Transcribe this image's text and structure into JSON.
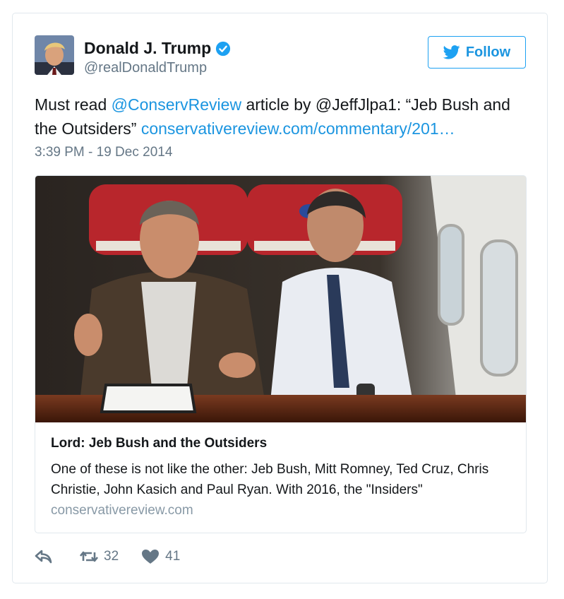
{
  "user": {
    "name": "Donald J. Trump",
    "handle": "@realDonaldTrump",
    "follow_label": "Follow"
  },
  "tweet": {
    "text_1": "Must read ",
    "mention_1": "@ConservReview",
    "text_2": " article by @JeffJlpa1: “Jeb Bush and the Outsiders” ",
    "url": "conservativereview.com/commentary/201…",
    "timestamp": "3:39 PM - 19 Dec 2014"
  },
  "card": {
    "title": "Lord: Jeb Bush and the Outsiders",
    "description": "One of these is not like the other: Jeb Bush, Mitt Romney, Ted Cruz, Chris Christie, John Kasich and Paul Ryan. With 2016, the \"Insiders\"",
    "domain": "conservativereview.com"
  },
  "actions": {
    "retweets": "32",
    "likes": "41"
  },
  "icons": {
    "verified": "verified-badge-icon",
    "follow": "twitter-bird-icon",
    "reply": "reply-icon",
    "retweet": "retweet-icon",
    "like": "heart-icon"
  },
  "colors": {
    "link": "#1b95e0",
    "verified": "#1da1f2",
    "secondary_text": "#657786",
    "border": "#e1e8ed"
  }
}
